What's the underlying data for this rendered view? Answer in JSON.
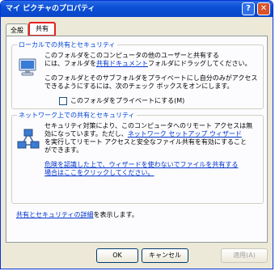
{
  "window": {
    "title": "マイ ピクチャのプロパティ"
  },
  "title_buttons": {
    "help": "?",
    "close": "✕"
  },
  "tabs": [
    {
      "label": "全般"
    },
    {
      "label": "共有"
    }
  ],
  "local": {
    "legend": "ローカルでの共有とセキュリティ",
    "para1_line1": "このフォルダをこのコンピュータの他のユーザーと共有する",
    "para1_line2_prefix": "には、フォルダを",
    "para1_line2_link": "共有ドキュメント",
    "para1_line2_suffix": "フォルダにドラッグしてください。",
    "para2_line1": "このフォルダとそのサブフォルダをプライベートにし自分のみがアクセス",
    "para2_line2": "できるようにするには、次のチェック ボックスをオンにします。",
    "private_checkbox_label": "このフォルダをプライベートにする(M)",
    "private_checked": false
  },
  "network": {
    "legend": "ネットワーク上での共有とセキュリティ",
    "line1": "セキュリティ対策により、このコンピュータへのリモート アクセスは無",
    "line2_prefix": "効になっています。ただし、",
    "line2_link": "ネットワーク セットアップ ウィザード",
    "line3": "を実行してリモート アクセスと安全なファイル共有を有効にすること",
    "line4": "ができます。",
    "risk_link_line1": "危険を認識した上で、ウィザードを使わないでファイルを共有する",
    "risk_link_line2": "場合はここをクリックしてください。"
  },
  "details": {
    "link": "共有とセキュリティの詳細",
    "suffix": "を表示します。"
  },
  "buttons": {
    "ok": "OK",
    "cancel": "キャンセル",
    "apply": "適用(A)"
  }
}
